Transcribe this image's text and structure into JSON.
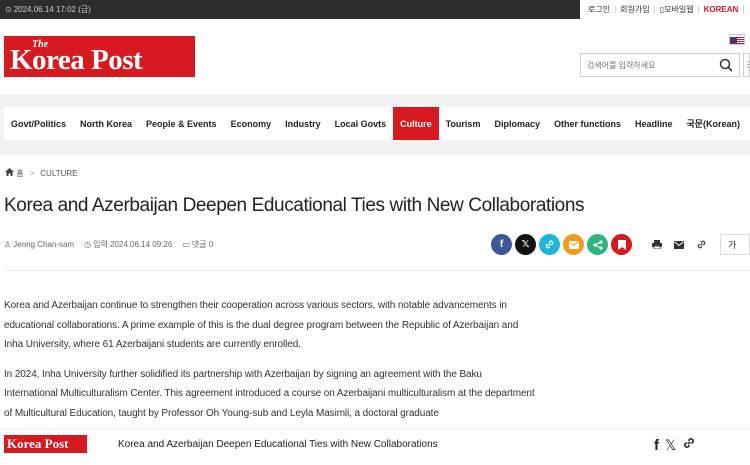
{
  "topbar": {
    "date": "2024.06.14 17:02 (금)",
    "links": [
      "로그인",
      "회원가입",
      "모바일웹",
      "KOREAN"
    ]
  },
  "logo": {
    "the": "The",
    "name": "Korea Post"
  },
  "search": {
    "placeholder": "검색어를 입력하세요"
  },
  "nav": {
    "items": [
      "Govt/Politics",
      "North Korea",
      "People & Events",
      "Economy",
      "Industry",
      "Local Govts",
      "Culture",
      "Tourism",
      "Diplomacy",
      "Other functions",
      "Headline",
      "국문(Korean)"
    ],
    "active": "Culture"
  },
  "breadcrumb": {
    "home": "홈",
    "section": "CULTURE"
  },
  "article": {
    "title": "Korea and Azerbaijan Deepen Educational Ties with New Collaborations",
    "author": "Jeong Chan-sam",
    "date": "입력 2024.06.14 09:26",
    "comments": "댓글 0",
    "paragraphs": [
      "Korea and Azerbaijan continue to strengthen their cooperation across various sectors, with notable advancements in educational collaborations. A prime example of this is the dual degree program between the Republic of Azerbaijan and Inha University, where 61 Azerbaijani students are currently enrolled.",
      "In 2024, Inha University further solidified its partnership with Azerbaijan by signing an agreement with the Baku International Multiculturalism Center. This agreement introduced a course on Azerbaijani multiculturalism at the department of Multicultural Education, taught by Professor Oh Young-sub and Leyla Masimli, a doctoral graduate"
    ]
  },
  "font_button": "가",
  "colors": {
    "brand": "#d71920",
    "facebook": "#3b5998",
    "x": "#111111",
    "link": "#1fb5d8",
    "email": "#f39a1e",
    "share": "#2cb67d",
    "bookmark": "#d71920"
  },
  "share_icons": [
    "facebook-icon",
    "x-icon",
    "link-icon",
    "email-icon",
    "share-icon",
    "bookmark-icon"
  ],
  "tool_icons": [
    "print-icon",
    "mail-icon",
    "link-icon"
  ],
  "sticky": {
    "logo": "Korea Post",
    "title": "Korea and Azerbaijan Deepen Educational Ties with New Collaborations"
  }
}
